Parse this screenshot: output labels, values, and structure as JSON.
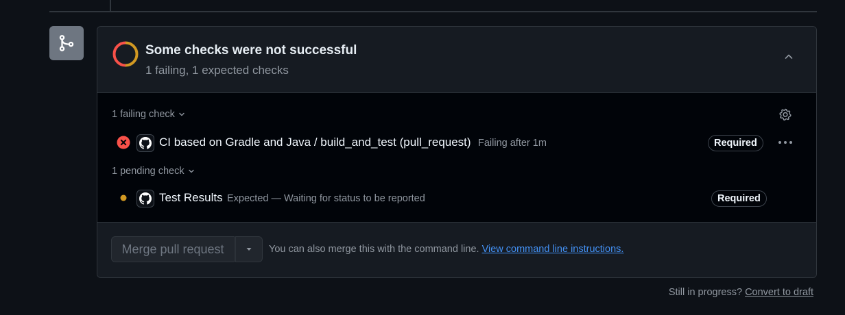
{
  "status": {
    "title": "Some checks were not successful",
    "subtitle": "1 failing, 1 expected checks",
    "colors": {
      "failing": "#f85149",
      "pending": "#d29922"
    }
  },
  "groups": {
    "failing": {
      "label": "1 failing check",
      "checks": [
        {
          "name": "CI based on Gradle and Java / build_and_test (pull_request)",
          "description": "Failing after 1m",
          "badge": "Required",
          "status_icon": "x-circle-icon"
        }
      ]
    },
    "pending": {
      "label": "1 pending check",
      "checks": [
        {
          "name": "Test Results",
          "description": "Expected — Waiting for status to be reported",
          "badge": "Required",
          "status_icon": "dot-icon"
        }
      ]
    }
  },
  "merge": {
    "button_label": "Merge pull request",
    "note": "You can also merge this with the command line.",
    "link": "View command line instructions."
  },
  "footer": {
    "text": "Still in progress?",
    "link": "Convert to draft"
  }
}
